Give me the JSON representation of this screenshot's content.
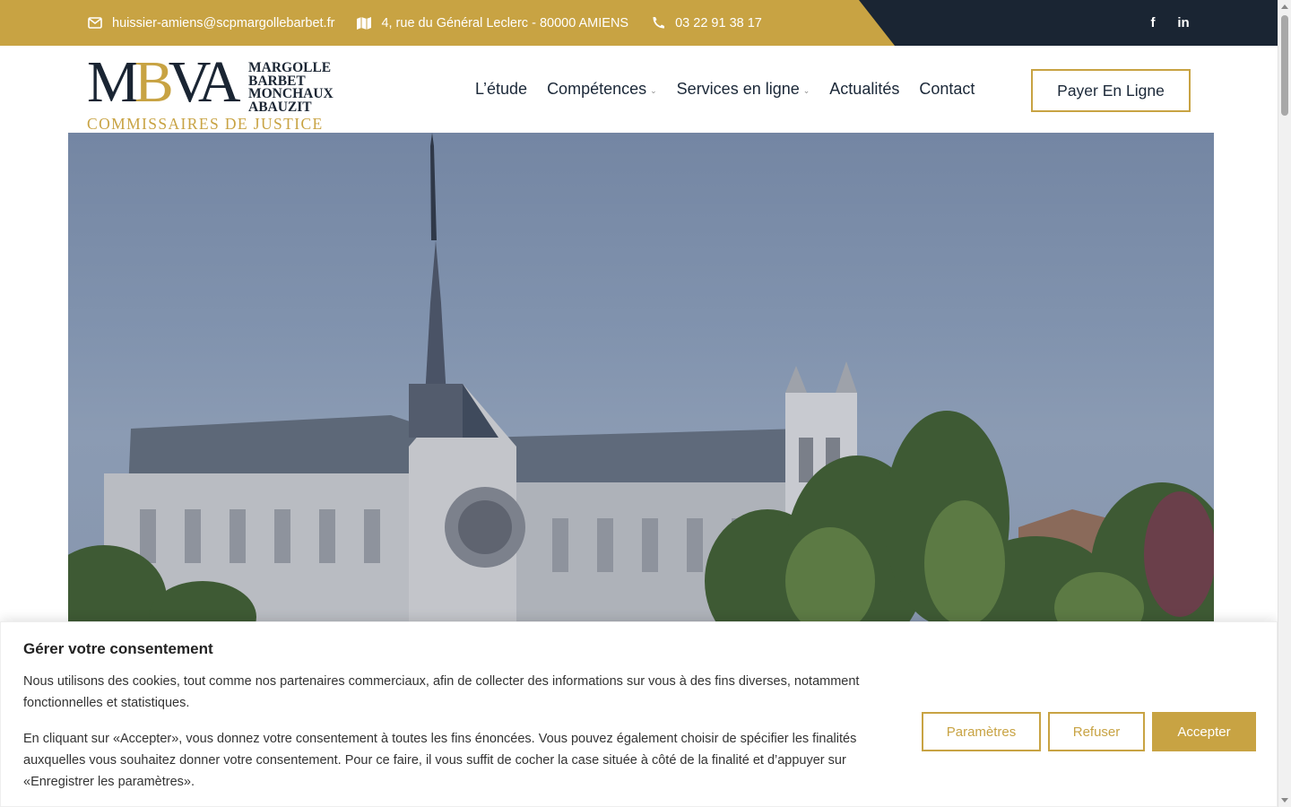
{
  "topbar": {
    "email": "huissier-amiens@scpmargollebarbet.fr",
    "address": "4, rue du Général Leclerc - 80000 AMIENS",
    "phone": "03 22 91 38 17",
    "social": [
      {
        "icon": "facebook-icon",
        "glyph": "f"
      },
      {
        "icon": "linkedin-icon",
        "glyph": "in"
      }
    ]
  },
  "logo": {
    "mark_m": "M",
    "mark_b": "B",
    "mark_va": "VA",
    "names": [
      "MARGOLLE",
      "BARBET",
      "MONCHAUX",
      "ABAUZIT"
    ],
    "subtitle": "COMMISSAIRES DE JUSTICE"
  },
  "nav": {
    "items": [
      {
        "label": "L’étude",
        "dropdown": false
      },
      {
        "label": "Compétences",
        "dropdown": true
      },
      {
        "label": "Services en ligne",
        "dropdown": true
      },
      {
        "label": "Actualités",
        "dropdown": false
      },
      {
        "label": "Contact",
        "dropdown": false
      }
    ],
    "cta": "Payer En Ligne"
  },
  "cookie": {
    "title": "Gérer votre consentement",
    "paragraph1": "Nous utilisons des cookies, tout comme nos partenaires commerciaux, afin de collecter des informations sur vous à des fins diverses, notamment fonctionnelles et statistiques.",
    "paragraph2": "En cliquant sur «Accepter», vous donnez votre consentement à toutes les fins énoncées. Vous pouvez également choisir de spécifier les finalités auxquelles vous souhaitez donner votre consentement. Pour ce faire, il vous suffit de cocher la case située à côté de la finalité et d’appuyer sur «Enregistrer les paramètres».",
    "buttons": {
      "params": "Paramètres",
      "refuse": "Refuser",
      "accept": "Accepter"
    }
  },
  "colors": {
    "gold": "#c8a343",
    "navy": "#1a2533"
  }
}
